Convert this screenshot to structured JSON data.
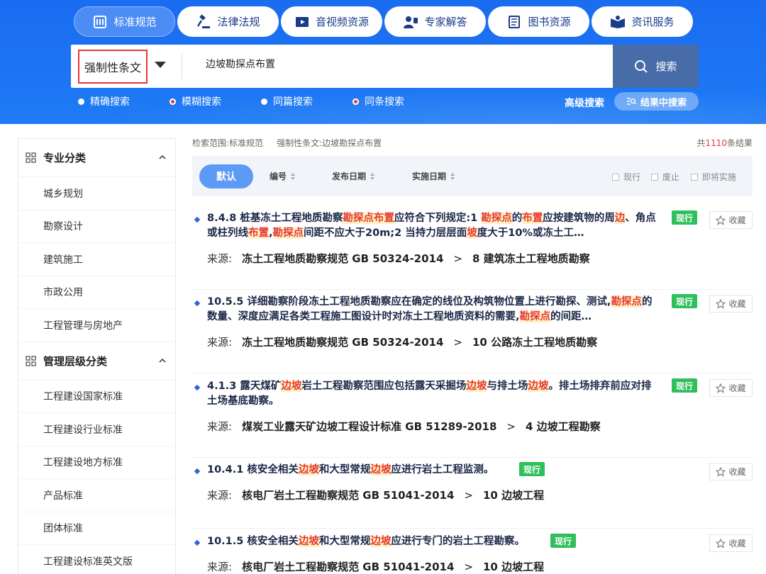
{
  "header": {
    "tabs": [
      {
        "label": "标准规范",
        "icon": "standard-icon",
        "active": true
      },
      {
        "label": "法律法规",
        "icon": "gavel-icon",
        "active": false
      },
      {
        "label": "音视频资源",
        "icon": "video-icon",
        "active": false
      },
      {
        "label": "专家解答",
        "icon": "expert-icon",
        "active": false
      },
      {
        "label": "图书资源",
        "icon": "book-icon",
        "active": false
      },
      {
        "label": "资讯服务",
        "icon": "news-icon",
        "active": false
      }
    ],
    "search": {
      "scope": "强制性条文",
      "query": "边坡勘探点布置",
      "button": "搜索"
    },
    "modes": [
      {
        "label": "精确搜索",
        "selected": false
      },
      {
        "label": "模糊搜索",
        "selected": true
      },
      {
        "label": "同篇搜索",
        "selected": false
      },
      {
        "label": "同条搜索",
        "selected": true
      }
    ],
    "advanced": "高级搜索",
    "in_result": "结果中搜索"
  },
  "sidebar": {
    "groups": [
      {
        "title": "专业分类",
        "items": [
          "城乡规划",
          "勘察设计",
          "建筑施工",
          "市政公用",
          "工程管理与房地产"
        ]
      },
      {
        "title": "管理层级分类",
        "items": [
          "工程建设国家标准",
          "工程建设行业标准",
          "工程建设地方标准",
          "产品标准",
          "团体标准",
          "工程建设标准英文版"
        ]
      }
    ]
  },
  "main": {
    "crumb_label": "检索范围:",
    "crumb_scope": "标准规范",
    "crumb_filter": "强制性条文:边坡勘探点布置",
    "total_prefix": "共",
    "total_count": "1110",
    "total_suffix": "条结果",
    "sort": {
      "default": "默认",
      "items": [
        "编号",
        "发布日期",
        "实施日期"
      ],
      "filters": [
        "现行",
        "废止",
        "即将实施"
      ]
    },
    "source_label": "来源:",
    "fav_label": "收藏",
    "results": [
      {
        "title_parts": [
          {
            "t": "8.4.8 桩基冻土工程地质勘察",
            "h": false
          },
          {
            "t": "勘探点布置",
            "h": true
          },
          {
            "t": "应符合下列规定:1 ",
            "h": false
          },
          {
            "t": "勘探点",
            "h": true
          },
          {
            "t": "的",
            "h": false
          },
          {
            "t": "布置",
            "h": true
          },
          {
            "t": "应按建筑物的周",
            "h": false
          },
          {
            "t": "边",
            "h": true
          },
          {
            "t": "、角点或柱列线",
            "h": false
          },
          {
            "t": "布置",
            "h": true
          },
          {
            "t": ",",
            "h": false
          },
          {
            "t": "勘探点",
            "h": true
          },
          {
            "t": "间距不应大于20m;2 当持力层层面",
            "h": false
          },
          {
            "t": "坡",
            "h": true
          },
          {
            "t": "度大于10%或冻土工…",
            "h": false
          }
        ],
        "badge": "现行",
        "source": "冻土工程地质勘察规范 GB 50324-2014",
        "chapter": "8 建筑冻土工程地质勘察"
      },
      {
        "title_parts": [
          {
            "t": "10.5.5 详细勘察阶段冻土工程地质勘察应在确定的线位及构筑物位置上进行勘探、测试,",
            "h": false
          },
          {
            "t": "勘探点",
            "h": true
          },
          {
            "t": "的数量、深度应满足各类工程施工图设计时对冻土工程地质资料的需要,",
            "h": false
          },
          {
            "t": "勘探点",
            "h": true
          },
          {
            "t": "的间距…",
            "h": false
          }
        ],
        "badge": "现行",
        "source": "冻土工程地质勘察规范 GB 50324-2014",
        "chapter": "10 公路冻土工程地质勘察"
      },
      {
        "title_parts": [
          {
            "t": "4.1.3 露天煤矿",
            "h": false
          },
          {
            "t": "边坡",
            "h": true
          },
          {
            "t": "岩土工程勘察范围应包括露天采掘场",
            "h": false
          },
          {
            "t": "边坡",
            "h": true
          },
          {
            "t": "与排土场",
            "h": false
          },
          {
            "t": "边坡",
            "h": true
          },
          {
            "t": "。排土场排弃前应对排土场基底勘察。",
            "h": false
          }
        ],
        "badge": "现行",
        "source": "煤炭工业露天矿边坡工程设计标准 GB 51289-2018",
        "chapter": "4 边坡工程勘察"
      },
      {
        "title_parts": [
          {
            "t": "10.4.1 核安全相关",
            "h": false
          },
          {
            "t": "边坡",
            "h": true
          },
          {
            "t": "和大型常规",
            "h": false
          },
          {
            "t": "边坡",
            "h": true
          },
          {
            "t": "应进行岩土工程监测。",
            "h": false
          }
        ],
        "badge": "现行",
        "source": "核电厂岩土工程勘察规范 GB 51041-2014",
        "chapter": "10 边坡工程"
      },
      {
        "title_parts": [
          {
            "t": "10.1.5 核安全相关",
            "h": false
          },
          {
            "t": "边坡",
            "h": true
          },
          {
            "t": "和大型常规",
            "h": false
          },
          {
            "t": "边坡",
            "h": true
          },
          {
            "t": "应进行专门的岩土工程勘察。",
            "h": false
          }
        ],
        "badge": "现行",
        "source": "核电厂岩土工程勘察规范 GB 51041-2014",
        "chapter": "10 边坡工程"
      }
    ]
  }
}
